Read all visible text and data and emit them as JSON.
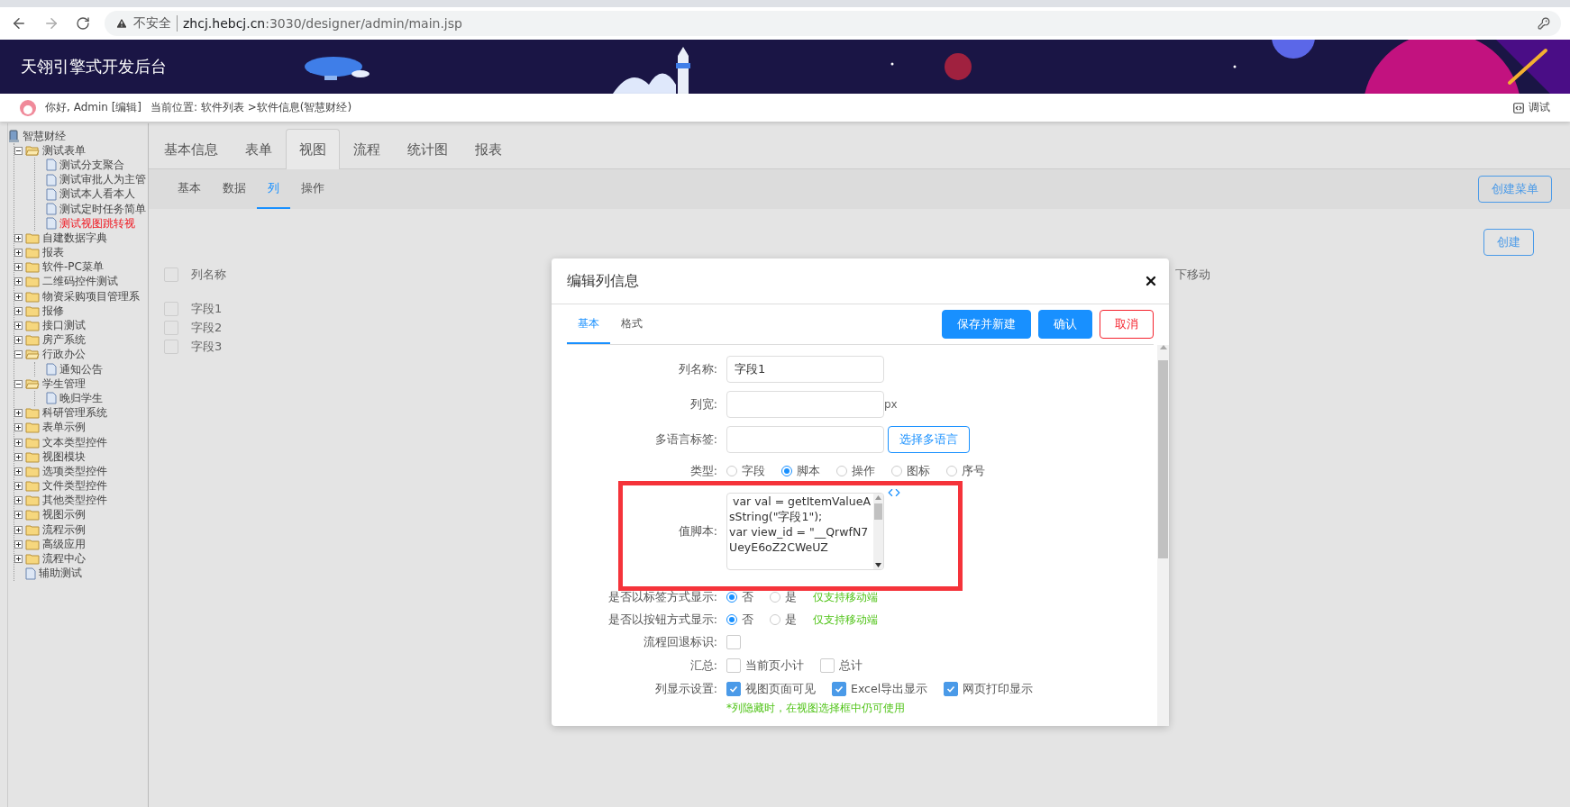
{
  "browser": {
    "security_label": "不安全",
    "url_host": "zhcj.hebcj.cn",
    "url_rest": ":3030/designer/admin/main.jsp"
  },
  "header": {
    "title": "天翎引擎式开发后台"
  },
  "user_bar": {
    "greeting": "你好, Admin [编辑]",
    "breadcrumb": "当前位置: 软件列表 >软件信息(智慧财经)",
    "debug_label": "调试"
  },
  "sidebar": {
    "tree": {
      "label": "智慧财经",
      "kind": "root",
      "selected": false,
      "children": [
        {
          "label": "测试表单",
          "kind": "folder",
          "expanded": true,
          "selected": false,
          "children": [
            {
              "label": "测试分支聚合",
              "kind": "file",
              "selected": false
            },
            {
              "label": "测试审批人为主管",
              "kind": "file",
              "selected": false
            },
            {
              "label": "测试本人看本人",
              "kind": "file",
              "selected": false
            },
            {
              "label": "测试定时任务简单",
              "kind": "file",
              "selected": false
            },
            {
              "label": "测试视图跳转视",
              "kind": "file",
              "selected": true
            }
          ]
        },
        {
          "label": "自建数据字典",
          "kind": "folder",
          "expanded": false,
          "selected": false
        },
        {
          "label": "报表",
          "kind": "folder",
          "expanded": false,
          "selected": false
        },
        {
          "label": "软件-PC菜单",
          "kind": "folder",
          "expanded": false,
          "selected": false
        },
        {
          "label": "二维码控件测试",
          "kind": "folder",
          "expanded": false,
          "selected": false
        },
        {
          "label": "物资采购项目管理系",
          "kind": "folder",
          "expanded": false,
          "selected": false
        },
        {
          "label": "报修",
          "kind": "folder",
          "expanded": false,
          "selected": false
        },
        {
          "label": "接口测试",
          "kind": "folder",
          "expanded": false,
          "selected": false
        },
        {
          "label": "房产系统",
          "kind": "folder",
          "expanded": false,
          "selected": false
        },
        {
          "label": "行政办公",
          "kind": "folder",
          "expanded": true,
          "selected": false,
          "children": [
            {
              "label": "通知公告",
              "kind": "file",
              "selected": false
            }
          ]
        },
        {
          "label": "学生管理",
          "kind": "folder",
          "expanded": true,
          "selected": false,
          "children": [
            {
              "label": "晚归学生",
              "kind": "file",
              "selected": false
            }
          ]
        },
        {
          "label": "科研管理系统",
          "kind": "folder",
          "expanded": false,
          "selected": false
        },
        {
          "label": "表单示例",
          "kind": "folder",
          "expanded": false,
          "selected": false
        },
        {
          "label": "文本类型控件",
          "kind": "folder",
          "expanded": false,
          "selected": false
        },
        {
          "label": "视图模块",
          "kind": "folder",
          "expanded": false,
          "selected": false
        },
        {
          "label": "选项类型控件",
          "kind": "folder",
          "expanded": false,
          "selected": false
        },
        {
          "label": "文件类型控件",
          "kind": "folder",
          "expanded": false,
          "selected": false
        },
        {
          "label": "其他类型控件",
          "kind": "folder",
          "expanded": false,
          "selected": false
        },
        {
          "label": "视图示例",
          "kind": "folder",
          "expanded": false,
          "selected": false
        },
        {
          "label": "流程示例",
          "kind": "folder",
          "expanded": false,
          "selected": false
        },
        {
          "label": "高级应用",
          "kind": "folder",
          "expanded": false,
          "selected": false
        },
        {
          "label": "流程中心",
          "kind": "folder",
          "expanded": false,
          "selected": false
        },
        {
          "label": "辅助测试",
          "kind": "file",
          "selected": false
        }
      ]
    }
  },
  "tabs": [
    {
      "label": "基本信息",
      "selected": false
    },
    {
      "label": "表单",
      "selected": false
    },
    {
      "label": "视图",
      "selected": true
    },
    {
      "label": "流程",
      "selected": false
    },
    {
      "label": "统计图",
      "selected": false
    },
    {
      "label": "报表",
      "selected": false
    }
  ],
  "subtabs": [
    {
      "label": "基本",
      "selected": false
    },
    {
      "label": "数据",
      "selected": false
    },
    {
      "label": "列",
      "selected": true
    },
    {
      "label": "操作",
      "selected": false
    }
  ],
  "toolbar": {
    "menu_button": "创建菜单",
    "create_button": "创建"
  },
  "table": {
    "header": {
      "label": "列名称",
      "checked": false
    },
    "column_2_header": "下移动",
    "rows": [
      {
        "label": "字段1",
        "checked": false
      },
      {
        "label": "字段2",
        "checked": false
      },
      {
        "label": "字段3",
        "checked": false
      }
    ]
  },
  "dialog": {
    "title": "编辑列信息",
    "tabs": [
      {
        "label": "基本",
        "selected": true
      },
      {
        "label": "格式",
        "selected": false
      }
    ],
    "buttons": [
      {
        "label": "保存并新建",
        "kind": "primary"
      },
      {
        "label": "确认",
        "kind": "primary"
      },
      {
        "label": "取消",
        "kind": "danger"
      }
    ],
    "fields": [
      {
        "kind": "input",
        "label": "列名称:",
        "value": "字段1"
      },
      {
        "kind": "input",
        "label": "列宽:",
        "unit": "px"
      },
      {
        "kind": "input",
        "label": "多语言标签:",
        "button": "选择多语言"
      },
      {
        "kind": "radio",
        "label": "类型:",
        "options": [
          {
            "label": "字段",
            "selected": false
          },
          {
            "label": "脚本",
            "selected": true
          },
          {
            "label": "操作",
            "selected": false
          },
          {
            "label": "图标",
            "selected": false
          },
          {
            "label": "序号",
            "selected": false
          }
        ]
      },
      {
        "kind": "script",
        "label": "值脚本:",
        "value": " var val = getItemValueAsString(\"字段1\");\nvar view_id = \"__QrwfN7UeyE6oZ2CWeUZ",
        "highlighted": true
      },
      {
        "kind": "radio",
        "label": "是否以标签方式显示:",
        "options": [
          {
            "label": "否",
            "selected": true
          },
          {
            "label": "是",
            "selected": false
          }
        ],
        "note": "仅支持移动端"
      },
      {
        "kind": "radio",
        "label": "是否以按钮方式显示:",
        "options": [
          {
            "label": "否",
            "selected": true
          },
          {
            "label": "是",
            "selected": false
          }
        ],
        "note": "仅支持移动端"
      },
      {
        "kind": "checkbox",
        "label": "流程回退标识:",
        "options": [
          {
            "checked": false
          }
        ]
      },
      {
        "kind": "checkbox",
        "label": "汇总:",
        "options": [
          {
            "label": "当前页小计",
            "checked": false
          },
          {
            "label": "总计",
            "checked": false
          }
        ]
      },
      {
        "kind": "checkbox",
        "label": "列显示设置:",
        "options": [
          {
            "label": "视图页面可见",
            "checked": true
          },
          {
            "label": "Excel导出显示",
            "checked": true
          },
          {
            "label": "网页打印显示",
            "checked": true
          }
        ],
        "note": "*列隐藏时，在视图选择框中仍可使用"
      }
    ]
  }
}
